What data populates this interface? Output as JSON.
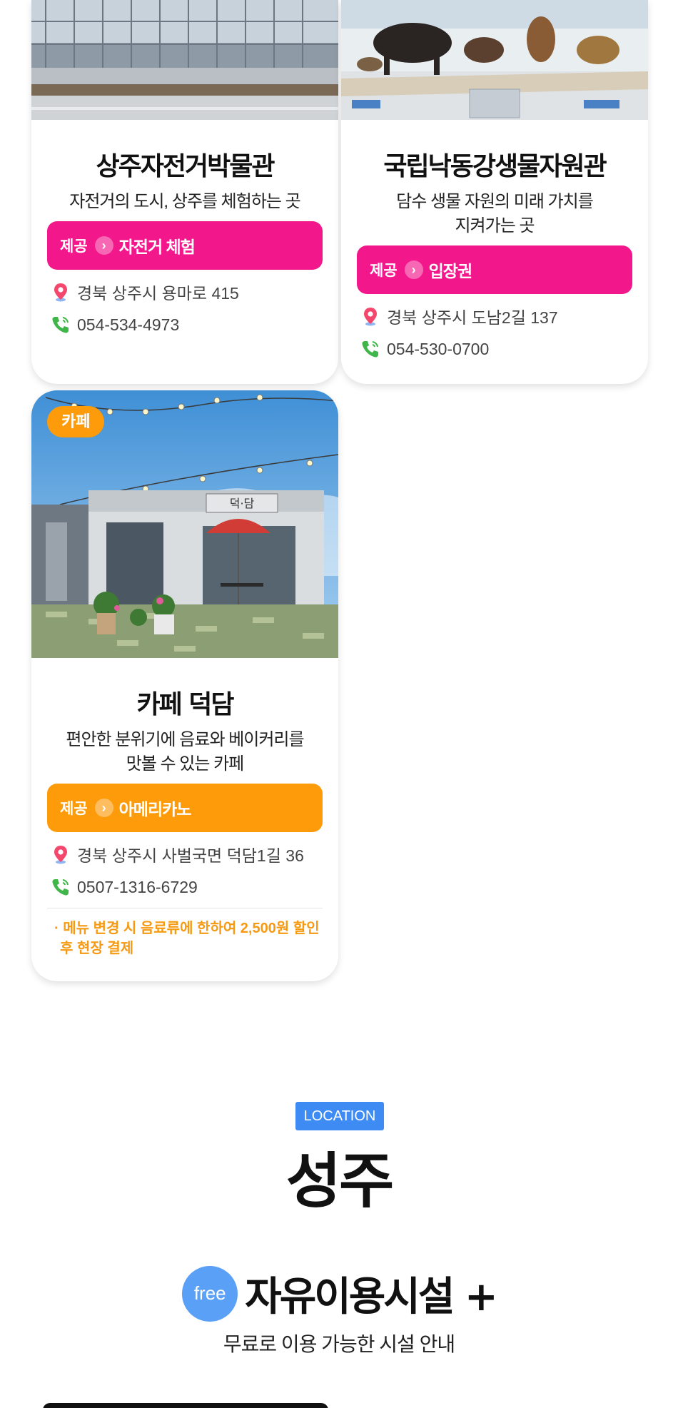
{
  "cards": [
    {
      "title": "상주자전거박물관",
      "desc": "자전거의 도시, 상주를 체험하는 곳",
      "offer_label": "제공",
      "offer": "자전거 체험",
      "address": "경북 상주시 용마로 415",
      "phone": "054-534-4973",
      "pill_color": "#f2188c"
    },
    {
      "title": "국립낙동강생물자원관",
      "desc_line1": "담수 생물 자원의 미래 가치를",
      "desc_line2": "지켜가는 곳",
      "offer_label": "제공",
      "offer": "입장권",
      "address": "경북 상주시 도남2길 137",
      "phone": "054-530-0700",
      "pill_color": "#f2188c"
    },
    {
      "badge": "카페",
      "title": "카페 덕담",
      "desc_line1": "편안한 분위기에 음료와 베이커리를",
      "desc_line2": "맛볼 수 있는 카페",
      "offer_label": "제공",
      "offer": "아메리카노",
      "address": "경북 상주시 사벌국면 덕담1길 36",
      "phone": "0507-1316-6729",
      "note_line1": "· 메뉴 변경 시 음료류에 한하여 2,500원 할인",
      "note_line2": "후 현장 결제",
      "pill_color": "#fe9b0b",
      "sign_text": "덕·담"
    }
  ],
  "location": {
    "tag": "LOCATION",
    "title": "성주"
  },
  "facility": {
    "badge": "free",
    "title": "자유이용시설 +",
    "subtitle": "무료로 이용 가능한 시설 안내"
  }
}
